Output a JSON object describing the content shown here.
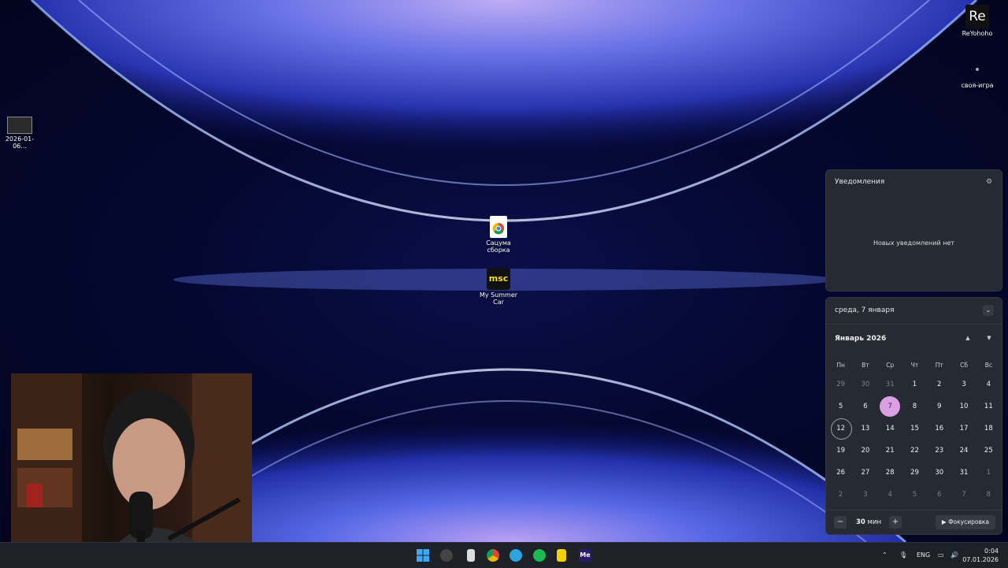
{
  "desktop": {
    "icons": [
      {
        "label": "2026-01-06..."
      },
      {
        "label": "Сацума сборка"
      },
      {
        "label": "My Summer Car"
      },
      {
        "label": "ReYohoho"
      },
      {
        "label": "своя-игра"
      }
    ],
    "reyohoho_logo": "Re",
    "msc_logo": "msc"
  },
  "notifications": {
    "title": "Уведомления",
    "empty_text": "Новых уведомлений нет",
    "settings_icon": "settings-icon"
  },
  "calendar": {
    "date_header": "среда, 7 января",
    "month_title": "Январь 2026",
    "weekdays": [
      "Пн",
      "Вт",
      "Ср",
      "Чт",
      "Пт",
      "Сб",
      "Вс"
    ],
    "weeks": [
      [
        "29",
        "30",
        "31",
        "1",
        "2",
        "3",
        "4"
      ],
      [
        "5",
        "6",
        "7",
        "8",
        "9",
        "10",
        "11"
      ],
      [
        "12",
        "13",
        "14",
        "15",
        "16",
        "17",
        "18"
      ],
      [
        "19",
        "20",
        "21",
        "22",
        "23",
        "24",
        "25"
      ],
      [
        "26",
        "27",
        "28",
        "29",
        "30",
        "31",
        "1"
      ],
      [
        "2",
        "3",
        "4",
        "5",
        "6",
        "7",
        "8"
      ]
    ],
    "today": "7",
    "today_color": "#d9a0e3",
    "focus": {
      "minus": "−",
      "minutes": "30",
      "unit": "мин",
      "plus": "+",
      "button_label": "Фокусировка"
    }
  },
  "taskbar": {
    "apps": [
      "windows-start",
      "obs",
      "file",
      "chrome",
      "telegram",
      "spotify",
      "app-yellow",
      "me-app"
    ],
    "me_label": "Me",
    "language": "ENG",
    "time": "0:04",
    "date": "07.01.2026"
  }
}
